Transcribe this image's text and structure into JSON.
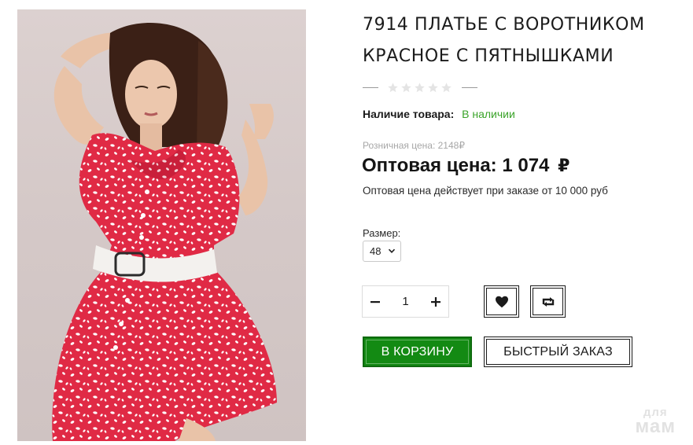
{
  "product": {
    "title_line1": "7914 ПЛАТЬЕ С ВОРОТНИКОМ",
    "title_line2": "КРАСНОЕ С ПЯТНЫШКАМИ",
    "photo_icon": "product-photo",
    "rating": {
      "stars_filled": 0,
      "stars_total": 5
    }
  },
  "availability": {
    "label": "Наличие товара:",
    "value": "В наличии",
    "value_color": "#3aa329"
  },
  "price": {
    "retail_label": "Розничная цена:",
    "retail_value": "2148",
    "retail_currency": "₽",
    "wholesale_label": "Оптовая цена:",
    "wholesale_value": "1 074",
    "wholesale_currency": "₽",
    "note": "Оптовая цена действует при заказе от 10 000 руб"
  },
  "size": {
    "label": "Размер:",
    "selected": "48"
  },
  "quantity": {
    "value": "1",
    "minus_icon": "minus-icon",
    "plus_icon": "plus-icon"
  },
  "actions": {
    "favorite_icon": "heart-icon",
    "compare_icon": "compare-icon",
    "cart_label": "В КОРЗИНУ",
    "cart_color": "#138a13",
    "quick_order_label": "БЫСТРЫЙ ЗАКАЗ"
  },
  "watermark": {
    "line1": "для",
    "line2": "мам"
  }
}
